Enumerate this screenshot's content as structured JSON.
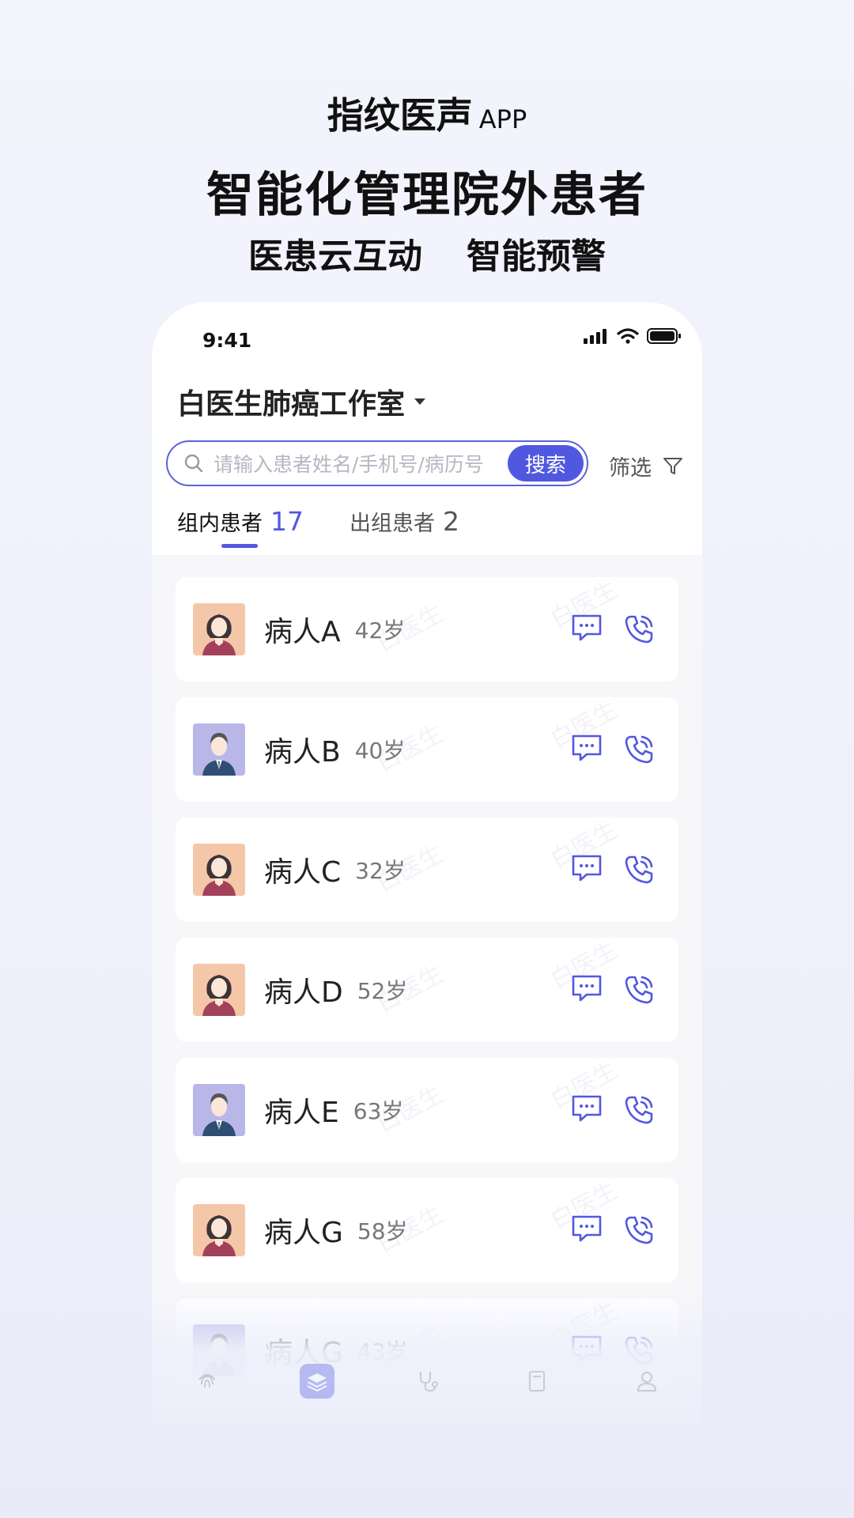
{
  "hero": {
    "app_name": "指纹医声",
    "app_suffix": "APP",
    "headline": "智能化管理院外患者",
    "feature_1": "医患云互动",
    "feature_2": "智能预警"
  },
  "status_bar": {
    "time": "9:41"
  },
  "header": {
    "studio_name": "白医生肺癌工作室"
  },
  "search": {
    "placeholder": "请输入患者姓名/手机号/病历号",
    "button_label": "搜索"
  },
  "filter": {
    "label": "筛选"
  },
  "tabs": [
    {
      "label": "组内患者",
      "count": "17",
      "active": true
    },
    {
      "label": "出组患者",
      "count": "2",
      "active": false
    }
  ],
  "patients": [
    {
      "name": "病人A",
      "age": "42岁",
      "avatar": "female"
    },
    {
      "name": "病人B",
      "age": "40岁",
      "avatar": "male"
    },
    {
      "name": "病人C",
      "age": "32岁",
      "avatar": "female"
    },
    {
      "name": "病人D",
      "age": "52岁",
      "avatar": "female"
    },
    {
      "name": "病人E",
      "age": "63岁",
      "avatar": "male"
    },
    {
      "name": "病人G",
      "age": "58岁",
      "avatar": "female"
    },
    {
      "name": "病人G",
      "age": "43岁",
      "avatar": "male"
    }
  ],
  "watermark": "白医生",
  "colors": {
    "accent": "#5158e0",
    "female_avatar_bg": "#f5c7a9",
    "male_avatar_bg": "#b9b7e8"
  },
  "bottom_nav": [
    "fingerprint-icon",
    "layers-icon",
    "stethoscope-icon",
    "book-icon",
    "user-icon"
  ]
}
